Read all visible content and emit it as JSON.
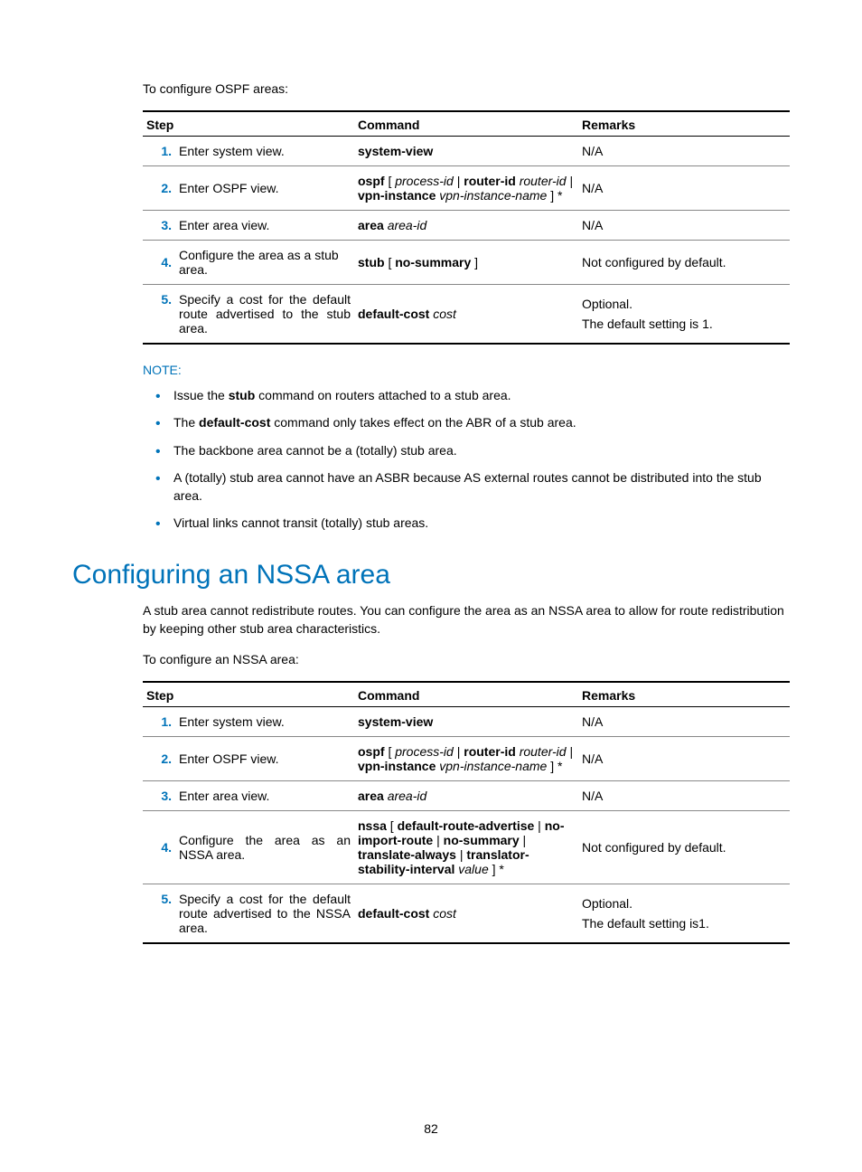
{
  "intro1": "To configure OSPF areas:",
  "table1": {
    "headers": {
      "step": "Step",
      "command": "Command",
      "remarks": "Remarks"
    },
    "rows": [
      {
        "num": "1.",
        "desc": "Enter system view.",
        "cmd_bold": "system-view",
        "remarks": "N/A"
      },
      {
        "num": "2.",
        "desc": "Enter OSPF view.",
        "cmd": {
          "ospf": "ospf",
          "lb": " [ ",
          "pid": "process-id",
          "pipe": " | ",
          "rid": "router-id",
          "ridi": " router-id",
          "pipe2": " | ",
          "vpn": "vpn-instance",
          "vpni": " vpn-instance-name",
          "rb": " ] *"
        },
        "remarks": "N/A"
      },
      {
        "num": "3.",
        "desc": "Enter area view.",
        "cmd": {
          "area": "area",
          "areaid": " area-id"
        },
        "remarks": "N/A"
      },
      {
        "num": "4.",
        "desc": "Configure the area as a stub area.",
        "cmd": {
          "stub": "stub",
          "lb": " [ ",
          "ns": "no-summary",
          "rb": " ]"
        },
        "remarks": "Not configured by default."
      },
      {
        "num": "5.",
        "desc": "Specify a cost for the default route advertised to the stub area.",
        "cmd": {
          "dc": "default-cost",
          "cost": " cost"
        },
        "remarks_l1": "Optional.",
        "remarks_l2": "The default setting is 1."
      }
    ]
  },
  "note_label": "NOTE:",
  "notes": {
    "n1a": "Issue the ",
    "n1b": "stub",
    "n1c": " command on routers attached to a stub area.",
    "n2a": "The ",
    "n2b": "default-cost",
    "n2c": " command only takes effect on the ABR of a stub area.",
    "n3": "The backbone area cannot be a (totally) stub area.",
    "n4": "A (totally) stub area cannot have an ASBR because AS external routes cannot be distributed into the stub area.",
    "n5": "Virtual links cannot transit (totally) stub areas."
  },
  "heading2": "Configuring an NSSA area",
  "para2": "A stub area cannot redistribute routes. You can configure the area as an NSSA area to allow for route redistribution by keeping other stub area characteristics.",
  "intro2": "To configure an NSSA area:",
  "table2": {
    "headers": {
      "step": "Step",
      "command": "Command",
      "remarks": "Remarks"
    },
    "rows": [
      {
        "num": "1.",
        "desc": "Enter system view.",
        "cmd_bold": "system-view",
        "remarks": "N/A"
      },
      {
        "num": "2.",
        "desc": "Enter OSPF view.",
        "cmd": {
          "ospf": "ospf",
          "lb": " [ ",
          "pid": "process-id",
          "pipe": " | ",
          "rid": "router-id",
          "ridi": " router-id",
          "pipe2": " | ",
          "vpn": "vpn-instance",
          "vpni": " vpn-instance-name",
          "rb": " ] *"
        },
        "remarks": "N/A"
      },
      {
        "num": "3.",
        "desc": "Enter area view.",
        "cmd": {
          "area": "area",
          "areaid": " area-id"
        },
        "remarks": "N/A"
      },
      {
        "num": "4.",
        "desc": "Configure the area as an NSSA area.",
        "cmd": {
          "nssa": "nssa",
          "lb": " [ ",
          "dra": "default-route-advertise",
          "p1": " | ",
          "nir": "no-import-route",
          "p2": " | ",
          "ns": "no-summary",
          "p3": " | ",
          "ta": "translate-always",
          "p4": " | ",
          "tsi": "translator-stability-interval",
          "val": " value",
          "rb": " ] *"
        },
        "remarks": "Not configured by default."
      },
      {
        "num": "5.",
        "desc": "Specify a cost for the default route advertised to the NSSA area.",
        "cmd": {
          "dc": "default-cost",
          "cost": " cost"
        },
        "remarks_l1": "Optional.",
        "remarks_l2": "The default setting is1."
      }
    ]
  },
  "page_number": "82"
}
